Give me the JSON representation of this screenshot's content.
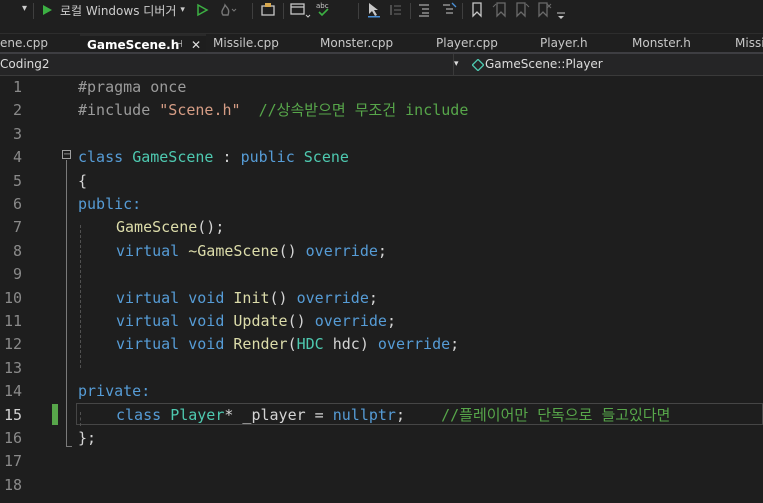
{
  "toolbar": {
    "debugger_label": "로컬 Windows 디버거",
    "dropdown_arrow": "▾"
  },
  "tabs": [
    {
      "label": "ene.cpp",
      "active": false
    },
    {
      "label": "GameScene.h",
      "active": true,
      "pin": "⊣",
      "close": "✕"
    },
    {
      "label": "Missile.cpp",
      "active": false
    },
    {
      "label": "Monster.cpp",
      "active": false
    },
    {
      "label": "Player.cpp",
      "active": false
    },
    {
      "label": "Player.h",
      "active": false
    },
    {
      "label": "Monster.h",
      "active": false
    },
    {
      "label": "Missi",
      "active": false
    }
  ],
  "navbar": {
    "project": "Coding2",
    "scope": "GameScene::Player"
  },
  "editor": {
    "line_numbers": [
      "1",
      "2",
      "3",
      "4",
      "5",
      "6",
      "7",
      "8",
      "9",
      "10",
      "11",
      "12",
      "13",
      "14",
      "15",
      "16",
      "17",
      "18"
    ],
    "current_line": "15",
    "fold_symbol": "−",
    "lines": {
      "l1_pp": "#pragma once",
      "l2_pp": "#include ",
      "l2_str": "\"Scene.h\"",
      "l2_cm": "  //상속받으면 무조건 include",
      "l4_kw1": "class ",
      "l4_ty1": "GameScene",
      "l4_p1": " : ",
      "l4_kw2": "public ",
      "l4_ty2": "Scene",
      "l5": "{",
      "l6": "public:",
      "l7_fn": "GameScene",
      "l7_p": "();",
      "l8_kw": "virtual ",
      "l8_fn": "~GameScene",
      "l8_p": "() ",
      "l8_kw2": "override",
      "l8_p2": ";",
      "l10_kw": "virtual ",
      "l10_kw2": "void ",
      "l10_fn": "Init",
      "l10_p": "() ",
      "l10_kw3": "override",
      "l10_p2": ";",
      "l11_kw": "virtual ",
      "l11_kw2": "void ",
      "l11_fn": "Update",
      "l11_p": "() ",
      "l11_kw3": "override",
      "l11_p2": ";",
      "l12_kw": "virtual ",
      "l12_kw2": "void ",
      "l12_fn": "Render",
      "l12_p": "(",
      "l12_ty": "HDC",
      "l12_p2": " hdc) ",
      "l12_kw3": "override",
      "l12_p3": ";",
      "l14": "private:",
      "l15_kw": "class ",
      "l15_ty": "Player",
      "l15_p": "* _player = ",
      "l15_kw2": "nullptr",
      "l15_p2": ";",
      "l15_cm": "    //플레이어만 단독으로 들고있다면",
      "l16": "};"
    }
  },
  "colors": {
    "keyword": "#569cd6",
    "preprocessor": "#9b9b9b",
    "string": "#d69d85",
    "comment": "#57a64a",
    "type": "#4ec9b0",
    "function": "#dcdcaa",
    "change_bar": "#57a64a",
    "run_green": "#3cb043"
  }
}
